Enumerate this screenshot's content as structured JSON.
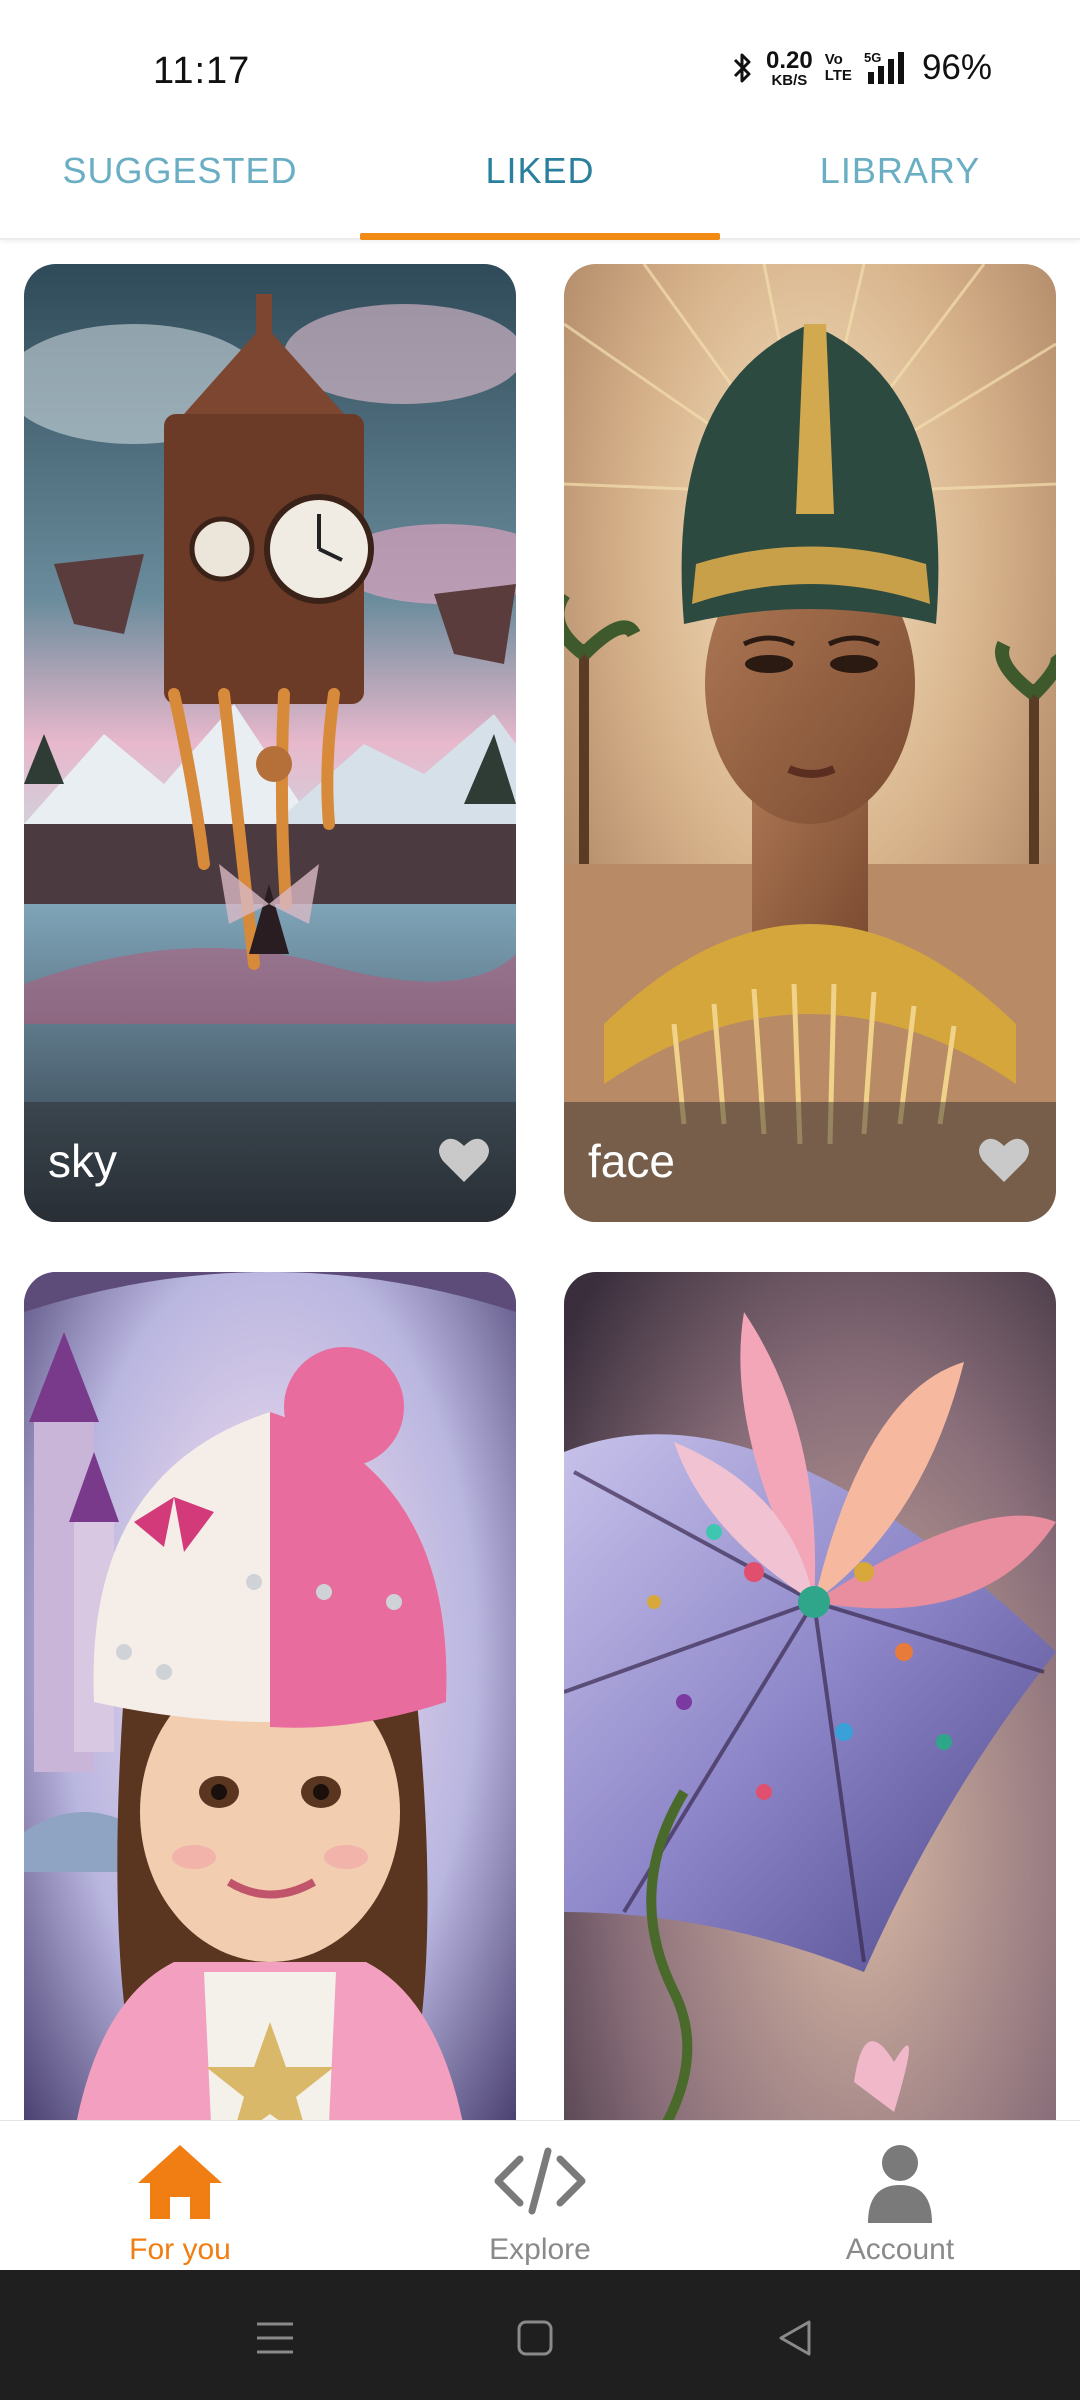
{
  "status_bar": {
    "time": "11:17",
    "network_speed_value": "0.20",
    "network_speed_unit": "KB/S",
    "volte_top": "Vo",
    "volte_bottom": "LTE",
    "signal_label": "5G",
    "battery": "96%"
  },
  "tabs": [
    {
      "label": "SUGGESTED",
      "active": false
    },
    {
      "label": "LIKED",
      "active": true
    },
    {
      "label": "LIBRARY",
      "active": false
    }
  ],
  "colors": {
    "accent": "#f28a16",
    "tab_text": "#6aaec3",
    "tab_active_text": "#2a7f9c",
    "nav_inactive": "#8a8a8a"
  },
  "cards": [
    {
      "caption": "sky",
      "liked": true,
      "icon": "heart-icon"
    },
    {
      "caption": "face",
      "liked": true,
      "icon": "heart-icon"
    },
    {
      "caption": "",
      "liked": true,
      "icon": "heart-icon"
    },
    {
      "caption": "",
      "liked": true,
      "icon": "heart-icon"
    }
  ],
  "bottom_nav": [
    {
      "label": "For you",
      "icon": "home-icon",
      "active": true
    },
    {
      "label": "Explore",
      "icon": "code-icon",
      "active": false
    },
    {
      "label": "Account",
      "icon": "person-icon",
      "active": false
    }
  ],
  "system_nav": [
    "menu-icon",
    "home-square-icon",
    "back-triangle-icon"
  ]
}
